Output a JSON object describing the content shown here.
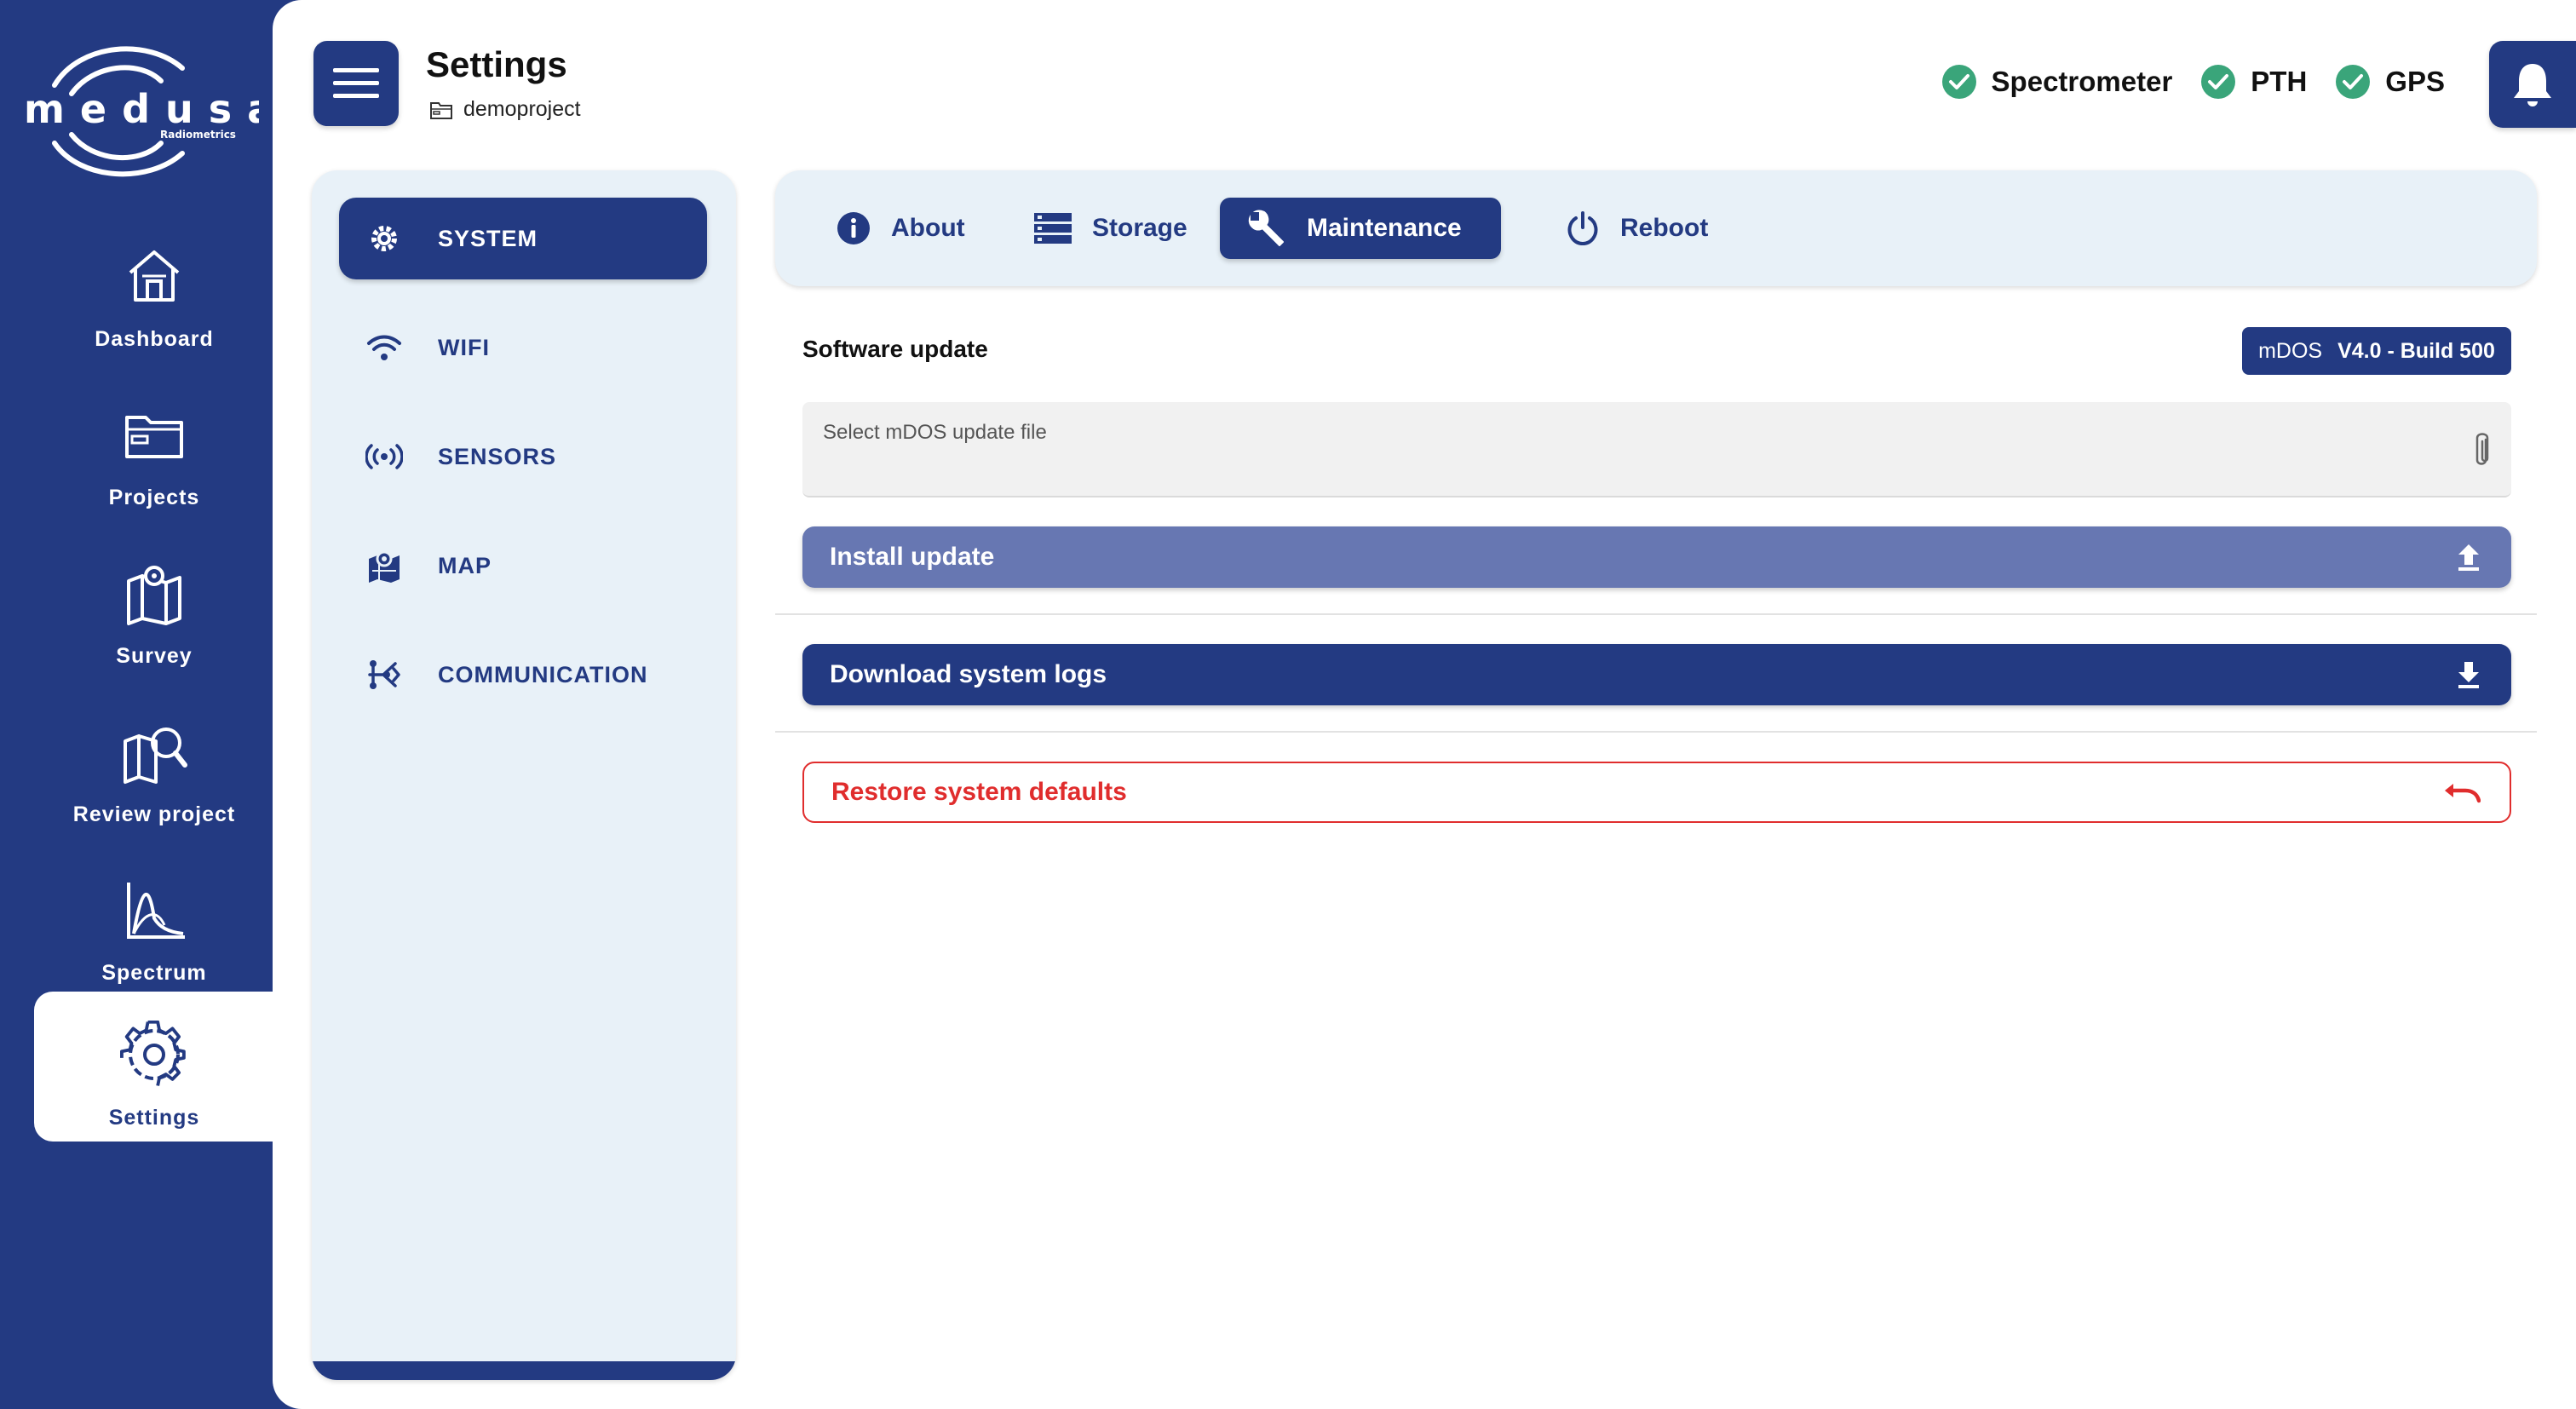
{
  "brand": {
    "name": "medusa",
    "tagline": "Radiometrics"
  },
  "sidebar": {
    "items": [
      {
        "label": "Dashboard",
        "icon": "home-icon",
        "active": false
      },
      {
        "label": "Projects",
        "icon": "folder-icon",
        "active": false
      },
      {
        "label": "Survey",
        "icon": "survey-map-icon",
        "active": false
      },
      {
        "label": "Review project",
        "icon": "map-search-icon",
        "active": false
      },
      {
        "label": "Spectrum",
        "icon": "spectrum-chart-icon",
        "active": false
      },
      {
        "label": "Settings",
        "icon": "gear-icon",
        "active": true
      }
    ]
  },
  "header": {
    "title": "Settings",
    "project": "demoproject",
    "statuses": [
      {
        "label": "Spectrometer",
        "state": "ok"
      },
      {
        "label": "PTH",
        "state": "ok"
      },
      {
        "label": "GPS",
        "state": "ok"
      }
    ]
  },
  "categories": [
    {
      "label": "SYSTEM",
      "icon": "gear-icon",
      "active": true
    },
    {
      "label": "WIFI",
      "icon": "wifi-icon",
      "active": false
    },
    {
      "label": "SENSORS",
      "icon": "broadcast-icon",
      "active": false
    },
    {
      "label": "MAP",
      "icon": "map-icon",
      "active": false
    },
    {
      "label": "COMMUNICATION",
      "icon": "share-icon",
      "active": false
    }
  ],
  "tabs": [
    {
      "label": "About",
      "icon": "info-icon",
      "active": false
    },
    {
      "label": "Storage",
      "icon": "storage-icon",
      "active": false
    },
    {
      "label": "Maintenance",
      "icon": "wrench-icon",
      "active": true
    },
    {
      "label": "Reboot",
      "icon": "power-icon",
      "active": false
    }
  ],
  "maintenance": {
    "section_title": "Software update",
    "version": {
      "prefix": "mDOS",
      "value": "V4.0 - Build 500"
    },
    "file_input": {
      "placeholder": "Select mDOS update file"
    },
    "install_button": "Install update",
    "logs_button": "Download system logs",
    "restore_button": "Restore system defaults"
  },
  "colors": {
    "primary": "#233a82",
    "panel": "#e8f1f8",
    "success": "#3aa57a",
    "danger": "#e02d2d",
    "disabled_primary": "#6777b2"
  }
}
